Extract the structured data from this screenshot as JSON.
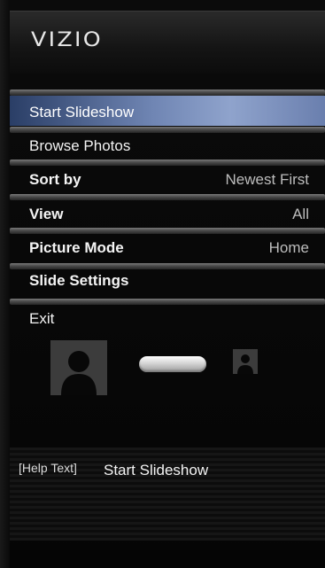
{
  "brand": {
    "logo": "VIZIO"
  },
  "menu": {
    "items": [
      {
        "label": "Start Slideshow",
        "value": ""
      },
      {
        "label": "Browse Photos",
        "value": ""
      },
      {
        "label": "Sort by",
        "value": "Newest First"
      },
      {
        "label": "View",
        "value": "All"
      },
      {
        "label": "Picture Mode",
        "value": "Home"
      },
      {
        "label": "Slide Settings",
        "value": ""
      },
      {
        "label": "Exit",
        "value": ""
      }
    ]
  },
  "help": {
    "tag": "[Help Text]",
    "text": "Start Slideshow"
  },
  "icons": {
    "large": "person-photo-icon",
    "slider": "slideshow-slider-icon",
    "small": "person-thumbnail-icon"
  },
  "colors": {
    "selected": "#6f85b3",
    "background": "#070707"
  }
}
